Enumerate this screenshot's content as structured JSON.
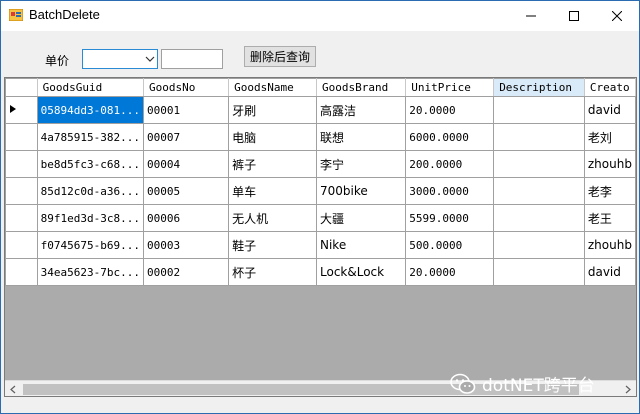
{
  "window": {
    "title": "BatchDelete"
  },
  "toolbar": {
    "price_label": "单价",
    "combo_value": "",
    "text_value": "",
    "query_button": "删除后查询"
  },
  "grid": {
    "columns": [
      "GoodsGuid",
      "GoodsNo",
      "GoodsName",
      "GoodsBrand",
      "UnitPrice",
      "Description",
      "Creato"
    ],
    "rows": [
      [
        "05894dd3-081...",
        "00001",
        "牙刷",
        "高露洁",
        "20.0000",
        "",
        "david"
      ],
      [
        "4a785915-382...",
        "00007",
        "电脑",
        "联想",
        "6000.0000",
        "",
        "老刘"
      ],
      [
        "be8d5fc3-c68...",
        "00004",
        "裤子",
        "李宁",
        "200.0000",
        "",
        "zhouhb"
      ],
      [
        "85d12c0d-a36...",
        "00005",
        "单车",
        "700bike",
        "3000.0000",
        "",
        "老李"
      ],
      [
        "89f1ed3d-3c8...",
        "00006",
        "无人机",
        "大疆",
        "5599.0000",
        "",
        "老王"
      ],
      [
        "f0745675-b69...",
        "00003",
        "鞋子",
        "Nike",
        "500.0000",
        "",
        "zhouhb"
      ],
      [
        "34ea5623-7bc...",
        "00002",
        "杯子",
        "Lock&Lock",
        "20.0000",
        "",
        "david"
      ]
    ]
  },
  "watermark": {
    "text": "dotNET跨平台"
  },
  "colors": {
    "selection": "#0078d7",
    "grid_background": "#ababab",
    "header_selected": "#d9ebf9"
  }
}
